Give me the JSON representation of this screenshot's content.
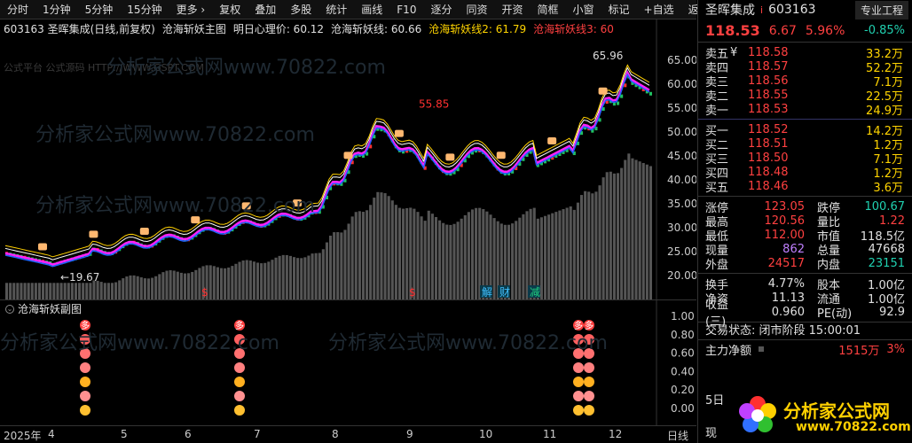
{
  "toolbar": {
    "items": [
      "分时",
      "1分钟",
      "5分钟",
      "15分钟",
      "更多 ›",
      "复权",
      "叠加",
      "多股",
      "统计",
      "画线",
      "F10",
      "逐分",
      "同资",
      "开资",
      "简框",
      "小窗",
      "标记",
      "+自选",
      "返回"
    ]
  },
  "legend": {
    "code_name": "603163 圣晖集成(日线,前复权)",
    "main_indicator": "沧海斩妖主图",
    "line1": "明日心理价: 60.12",
    "line2": "沧海斩妖线: 60.66",
    "line3": "沧海斩妖线2: 61.79",
    "line4": "沧海斩妖线3: 60"
  },
  "watermarks": {
    "small": "公式平台 公式源码 HTTP://WWW.GSPT.COM",
    "big": "分析家公式网www.70822.com"
  },
  "main_chart": {
    "price_axis": [
      "65.00",
      "60.00",
      "55.00",
      "50.00",
      "45.00",
      "40.00",
      "35.00",
      "30.00",
      "25.00",
      "20.00"
    ],
    "annotations": {
      "high": "65.96",
      "mid_high": "55.85",
      "low": "←19.67"
    },
    "markers": [
      "$",
      "$",
      "解",
      "财",
      "减"
    ]
  },
  "sub_chart": {
    "title": "沧海斩妖副图",
    "axis": [
      "1.00",
      "0.80",
      "0.60",
      "0.40",
      "0.20",
      "0.00"
    ],
    "badge": "多"
  },
  "time_axis": {
    "labels": [
      "2025年",
      "4",
      "5",
      "6",
      "7",
      "8",
      "9",
      "10",
      "11",
      "12"
    ],
    "right_label": "日线"
  },
  "quote": {
    "name": "圣晖集成",
    "flag": "i",
    "code": "603163",
    "tag": "专业工程",
    "price": "118.53",
    "change": "6.67",
    "pct": "5.96%",
    "tag_pct": "-0.85%",
    "asks": [
      {
        "label": "卖五",
        "suffix": "¥",
        "price": "118.58",
        "vol": "33.2万"
      },
      {
        "label": "卖四",
        "suffix": "",
        "price": "118.57",
        "vol": "52.2万"
      },
      {
        "label": "卖三",
        "suffix": "",
        "price": "118.56",
        "vol": "7.1万"
      },
      {
        "label": "卖二",
        "suffix": "",
        "price": "118.55",
        "vol": "22.5万"
      },
      {
        "label": "卖一",
        "suffix": "",
        "price": "118.53",
        "vol": "24.9万"
      }
    ],
    "bids": [
      {
        "label": "买一",
        "price": "118.52",
        "vol": "14.2万"
      },
      {
        "label": "买二",
        "price": "118.51",
        "vol": "1.2万"
      },
      {
        "label": "买三",
        "price": "118.50",
        "vol": "7.1万"
      },
      {
        "label": "买四",
        "price": "118.48",
        "vol": "1.2万"
      },
      {
        "label": "买五",
        "price": "118.46",
        "vol": "3.6万"
      }
    ],
    "stats": [
      {
        "k1": "涨停",
        "v1": "123.05",
        "c1": "red",
        "k2": "跌停",
        "v2": "100.67",
        "c2": "green"
      },
      {
        "k1": "最高",
        "v1": "120.56",
        "c1": "red",
        "k2": "量比",
        "v2": "1.22",
        "c2": "red"
      },
      {
        "k1": "最低",
        "v1": "112.00",
        "c1": "red",
        "k2": "市值",
        "v2": "118.5亿",
        "c2": "white"
      },
      {
        "k1": "现量",
        "v1": "862",
        "c1": "purple",
        "k2": "总量",
        "v2": "47668",
        "c2": "white"
      },
      {
        "k1": "外盘",
        "v1": "24517",
        "c1": "red",
        "k2": "内盘",
        "v2": "23151",
        "c2": "green"
      }
    ],
    "stats2": [
      {
        "k1": "换手",
        "v1": "4.77%",
        "k2": "股本",
        "v2": "1.00亿"
      },
      {
        "k1": "净资",
        "v1": "11.13",
        "k2": "流通",
        "v2": "1.00亿"
      },
      {
        "k1": "收益(三)",
        "v1": "0.960",
        "k2": "PE(动)",
        "v2": "92.9"
      }
    ],
    "trade_status": "交易状态: 闭市阶段 15:00:01",
    "main_net": {
      "label": "主力净额",
      "value": "1515万",
      "pct": "3%"
    },
    "day_label": "5日",
    "cut_label": "现",
    "logo_text": "分析家公式网",
    "logo_url": "www.70822.com"
  }
}
